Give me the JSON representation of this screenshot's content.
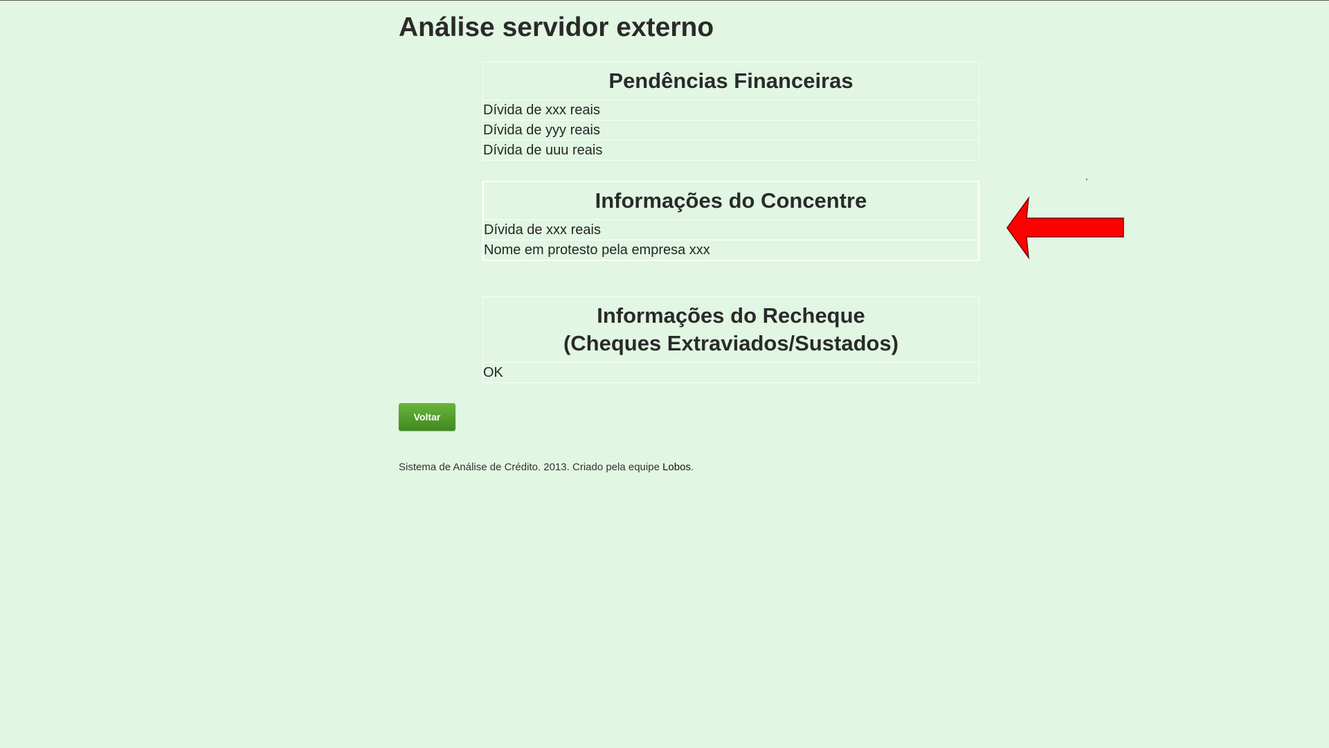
{
  "page": {
    "title": "Análise servidor externo"
  },
  "sections": [
    {
      "title_lines": [
        "Pendências Financeiras"
      ],
      "rows": [
        "Dívida de xxx reais",
        "Dívida de yyy reais",
        "Dívida de uuu reais"
      ]
    },
    {
      "title_lines": [
        "Informações do Concentre"
      ],
      "rows": [
        "Dívida de xxx reais",
        "Nome em protesto pela empresa xxx"
      ]
    },
    {
      "title_lines": [
        "Informações do Recheque",
        "(Cheques Extraviados/Sustados)"
      ],
      "rows": [
        "OK"
      ]
    }
  ],
  "actions": {
    "back_label": "Voltar"
  },
  "footer": {
    "text_before": "Sistema de Análise de Crédito. 2013. Criado pela equipe ",
    "link_text": "Lobos",
    "text_after": "."
  },
  "colors": {
    "background": "#e1f6e3",
    "button": "#4e9a28",
    "annotation_arrow": "#ff0000"
  },
  "icons": {
    "annotation": "left-arrow-icon"
  }
}
